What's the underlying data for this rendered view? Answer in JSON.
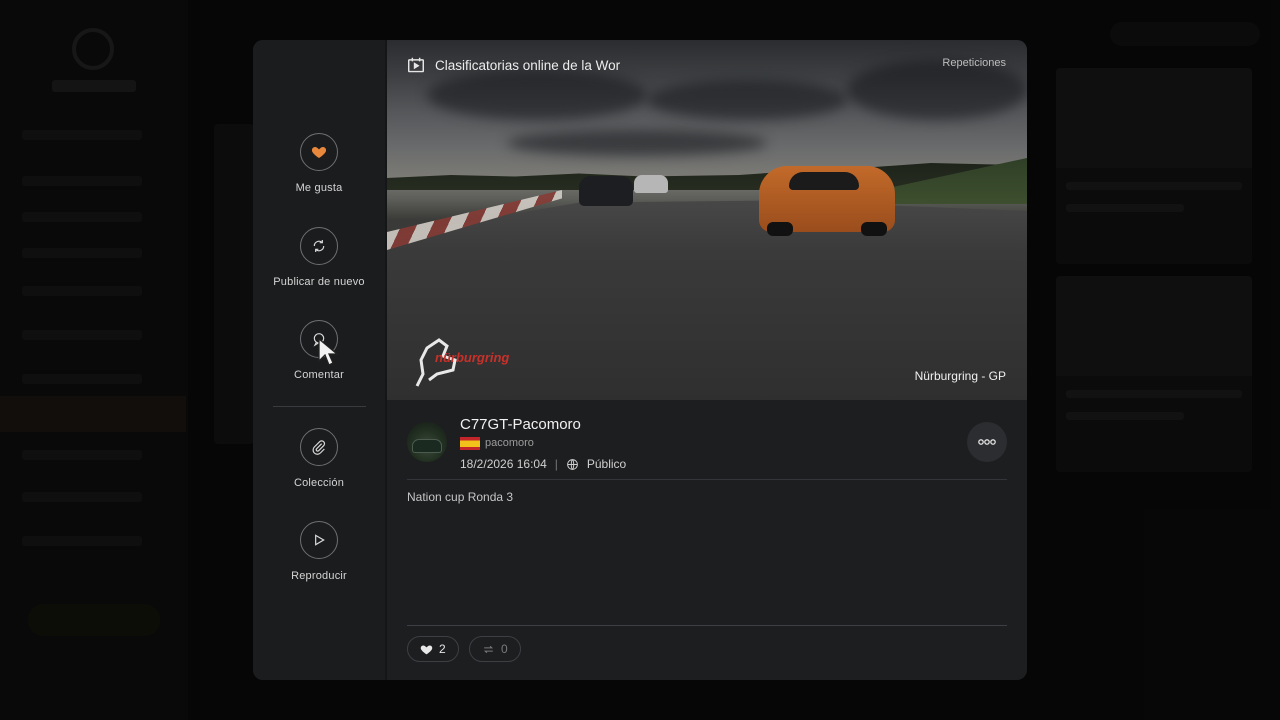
{
  "media": {
    "title": "Clasificatorias online de la Wor",
    "category": "Repeticiones",
    "track_name": "Nürburgring - GP",
    "logo_text": "nürburgring"
  },
  "actions": [
    {
      "label": "Me gusta",
      "icon": "heart-icon"
    },
    {
      "label": "Publicar de nuevo",
      "icon": "repost-icon"
    },
    {
      "label": "Comentar",
      "icon": "comment-icon"
    },
    {
      "label": "Colección",
      "icon": "paperclip-icon"
    },
    {
      "label": "Reproducir",
      "icon": "play-icon"
    }
  ],
  "post": {
    "username": "C77GT-Pacomoro",
    "handle": "pacomoro",
    "country_flag": "spain-flag",
    "datetime": "18/2/2026 16:04",
    "separator": "|",
    "visibility": "Público",
    "description": "Nation  cup Ronda 3"
  },
  "stats": {
    "likes": "2",
    "reposts": "0"
  },
  "colors": {
    "accent": "#e8883c",
    "modal_bg": "#1d1e20",
    "logo_red": "#c8302a"
  }
}
